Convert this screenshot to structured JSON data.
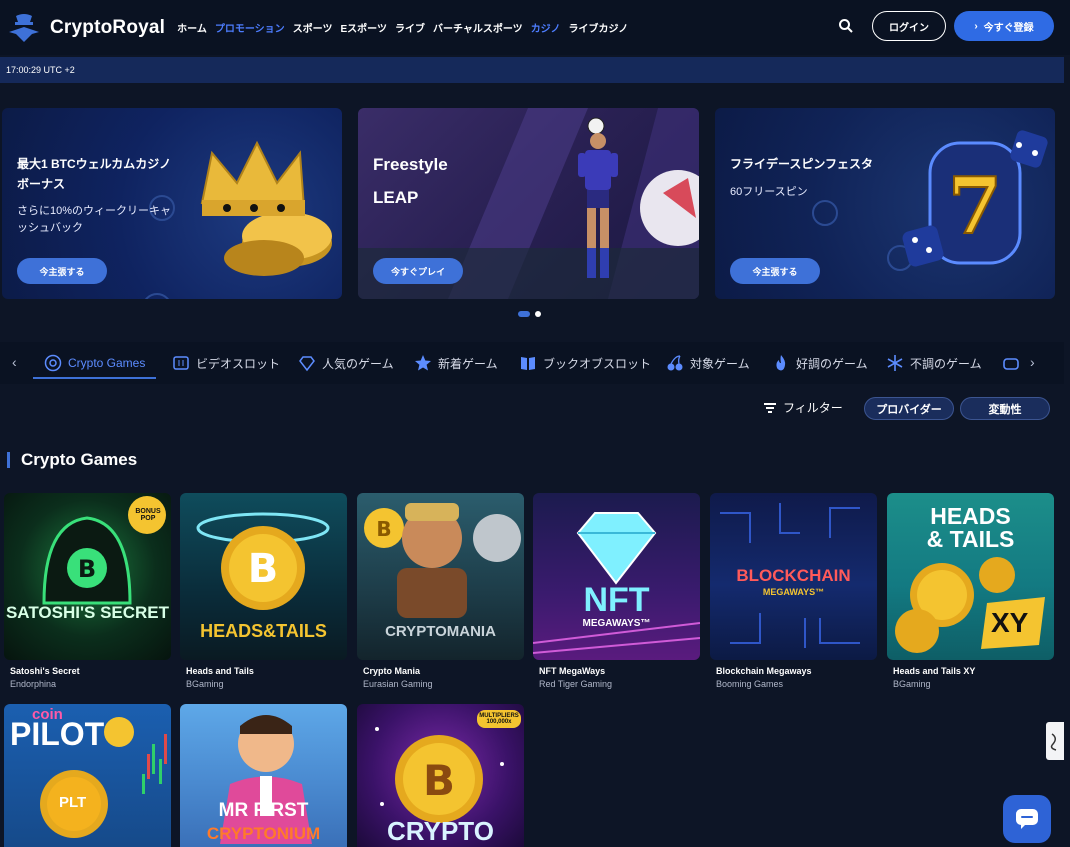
{
  "header": {
    "brand": "CryptoRoyal",
    "nav": [
      {
        "label": "ホーム",
        "active": false
      },
      {
        "label": "プロモーション",
        "active": true
      },
      {
        "label": "スポーツ",
        "active": false
      },
      {
        "label": "Eスポーツ",
        "active": false
      },
      {
        "label": "ライブ",
        "active": false
      },
      {
        "label": "バーチャルスポーツ",
        "active": false
      },
      {
        "label": "カジノ",
        "active": true
      },
      {
        "label": "ライブカジノ",
        "active": false
      }
    ],
    "login_label": "ログイン",
    "register_label": "今すぐ登録"
  },
  "timebar": {
    "time": "17:00:29 UTC +2"
  },
  "banners": [
    {
      "title_line1": "最大1 BTCウェルカムカジノ",
      "title_line2": "ボーナス",
      "sub_line1": "さらに10%のウィークリーキャ",
      "sub_line2": "ッシュバック",
      "button": "今主張する"
    },
    {
      "title_line1": "Freestyle",
      "title_line2": "LEAP",
      "button": "今すぐプレイ"
    },
    {
      "title": "フライデースピンフェスタ",
      "sub": "60フリースピン",
      "button": "今主張する"
    }
  ],
  "categories": [
    {
      "label": "Crypto Games",
      "icon": "crypto-games-icon",
      "active": true
    },
    {
      "label": "ビデオスロット",
      "icon": "slot-machine-icon",
      "active": false
    },
    {
      "label": "人気のゲーム",
      "icon": "diamond-icon",
      "active": false
    },
    {
      "label": "新着ゲーム",
      "icon": "star-icon",
      "active": false
    },
    {
      "label": "ブックオブスロット",
      "icon": "book-icon",
      "active": false
    },
    {
      "label": "対象ゲーム",
      "icon": "cherries-icon",
      "active": false
    },
    {
      "label": "好調のゲーム",
      "icon": "flame-icon",
      "active": false
    },
    {
      "label": "不調のゲーム",
      "icon": "snowflake-icon",
      "active": false
    }
  ],
  "filters": {
    "label": "フィルター",
    "provider": "プロバイダー",
    "volatility": "変動性"
  },
  "section": {
    "title": "Crypto Games"
  },
  "games": [
    {
      "name": "Satoshi's Secret",
      "provider": "Endorphina",
      "art": "SATOSHI'S SECRET",
      "badge": "BONUS POP"
    },
    {
      "name": "Heads and Tails",
      "provider": "BGaming",
      "art": "HEADS&TAILS"
    },
    {
      "name": "Crypto Mania",
      "provider": "Eurasian Gaming",
      "art": "CRYPTOMANIA"
    },
    {
      "name": "NFT MegaWays",
      "provider": "Red Tiger Gaming",
      "art": "NFT",
      "art_sub": "MEGAWAYS™"
    },
    {
      "name": "Blockchain Megaways",
      "provider": "Booming Games",
      "art": "BLOCKCHAIN",
      "art_sub": "MEGAWAYS™"
    },
    {
      "name": "Heads and Tails XY",
      "provider": "BGaming",
      "art": "HEADS",
      "art2": "& TAILS",
      "art3": "XY"
    }
  ],
  "games_row2": [
    {
      "art": "coin",
      "art2": "PILOT",
      "badge": "PLT"
    },
    {
      "art": "MR FIRST",
      "art2": "CRYPTONIUM"
    },
    {
      "art": "CRYPTO",
      "badge": "MULTIPLIERS 100,000x"
    }
  ]
}
